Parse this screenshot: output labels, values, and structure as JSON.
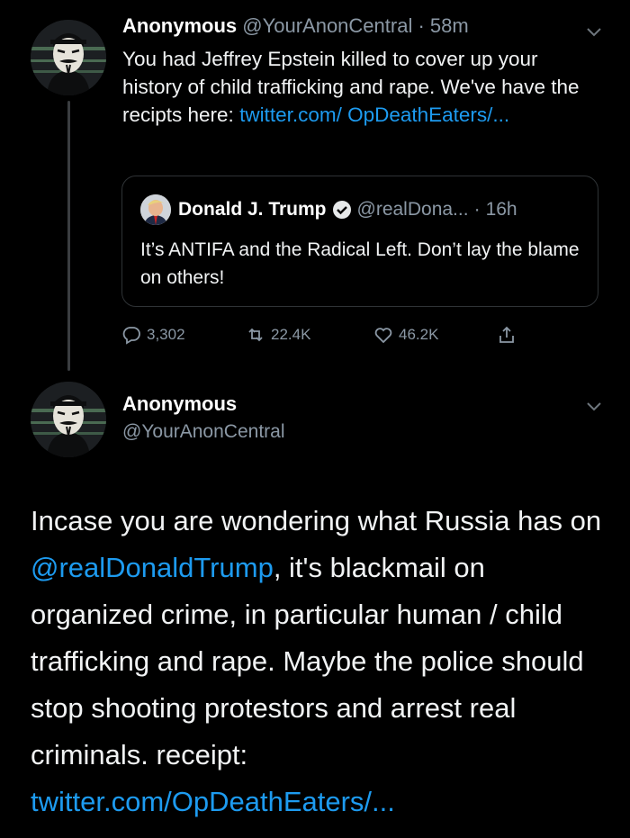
{
  "tweet1": {
    "author_name": "Anonymous",
    "author_handle": "@YourAnonCentral",
    "separator": "·",
    "time": "58m",
    "text_before_link": "You had Jeffrey Epstein killed to cover up your history of child trafficking and rape. We've have the recipts here: ",
    "link": "twitter.com/ OpDeathEaters/...",
    "quote": {
      "author_name": "Donald J. Trump",
      "author_handle": "@realDona...",
      "separator": "·",
      "time": "16h",
      "text": "It’s ANTIFA and the Radical Left. Don’t lay the blame on others!"
    },
    "actions": {
      "replies": "3,302",
      "retweets": "22.4K",
      "likes": "46.2K"
    }
  },
  "tweet2": {
    "author_name": "Anonymous",
    "author_handle": "@YourAnonCentral",
    "text_part1": "Incase you are wondering what Russia has on ",
    "mention": "@realDonaldTrump",
    "text_part2": ", it's blackmail on organized crime, in particular human / child trafficking and rape. Maybe the police should stop shooting protestors and arrest real criminals. receipt: ",
    "link": "twitter.com/OpDeathEaters/..."
  },
  "icons": {
    "reply": "reply-icon",
    "retweet": "retweet-icon",
    "like": "heart-icon",
    "share": "share-icon",
    "verified": "verified-badge-icon",
    "more": "chevron-down-icon"
  },
  "colors": {
    "background": "#000000",
    "link": "#1d9bf0",
    "muted": "#8b98a5"
  }
}
